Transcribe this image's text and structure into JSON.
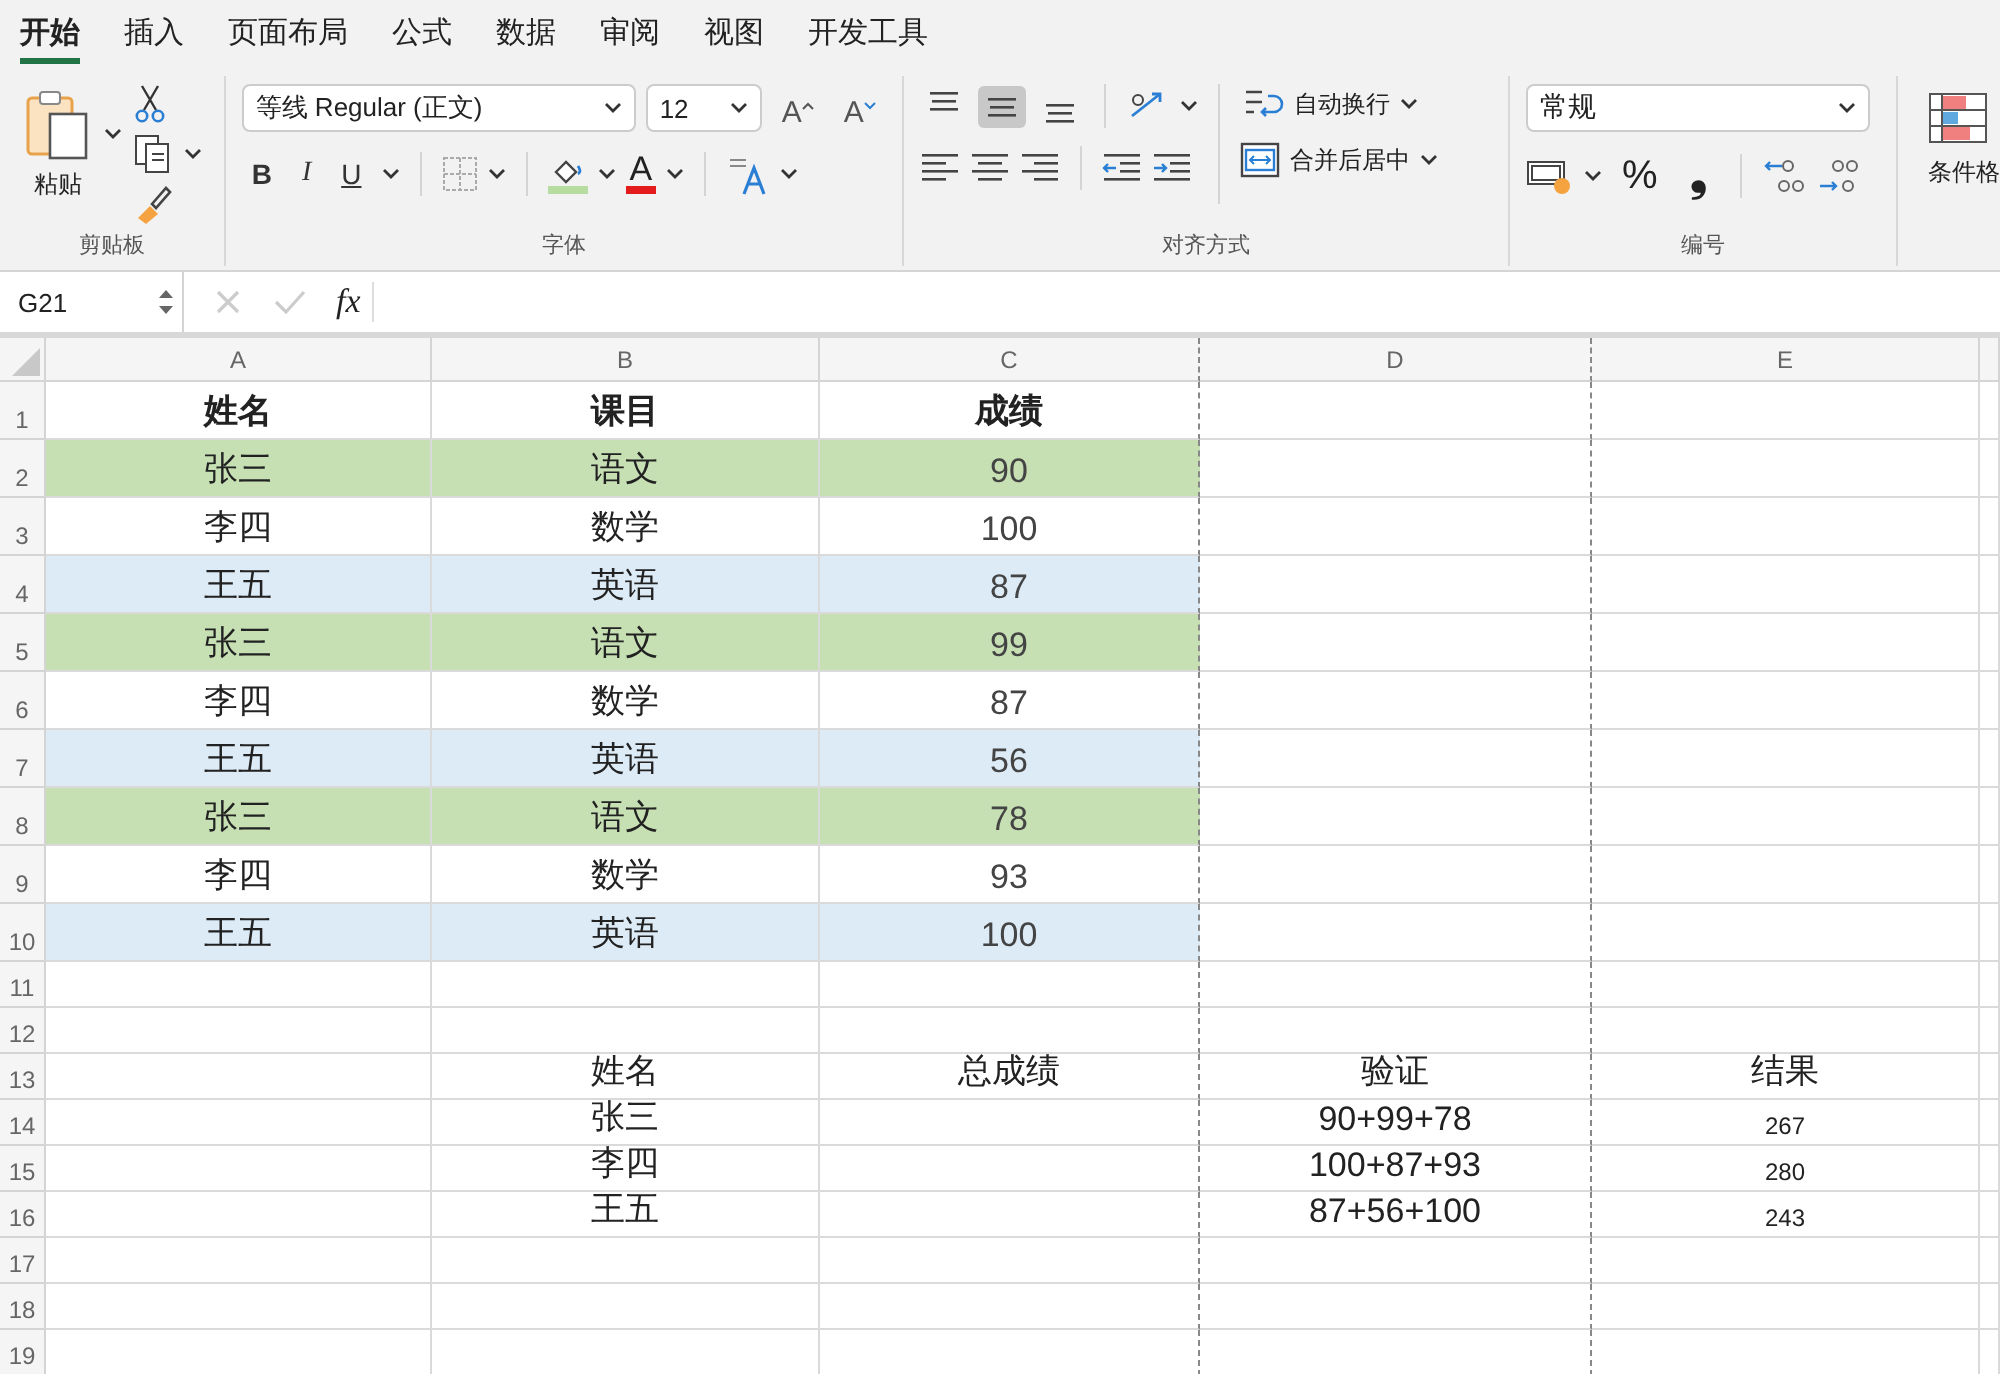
{
  "tabs": [
    {
      "label": "开始",
      "selected": true
    },
    {
      "label": "插入",
      "selected": false
    },
    {
      "label": "页面布局",
      "selected": false
    },
    {
      "label": "公式",
      "selected": false
    },
    {
      "label": "数据",
      "selected": false
    },
    {
      "label": "审阅",
      "selected": false
    },
    {
      "label": "视图",
      "selected": false
    },
    {
      "label": "开发工具",
      "selected": false
    }
  ],
  "ribbon": {
    "clipboard": {
      "paste_label": "粘贴",
      "group_label": "剪贴板"
    },
    "font": {
      "font_name": "等线 Regular (正文)",
      "font_size": "12",
      "size_buttons": [
        "A",
        "A"
      ],
      "style_buttons": [
        "B",
        "I",
        "U"
      ],
      "font_color_label": "A",
      "group_label": "字体"
    },
    "alignment": {
      "vertical_align": [
        {
          "selected": false
        },
        {
          "selected": true
        },
        {
          "selected": false
        }
      ],
      "wrap_label": "自动换行",
      "merge_label": "合并后居中",
      "group_label": "对齐方式"
    },
    "number": {
      "format": "常规",
      "percent": "%",
      "comma": "❟",
      "group_label": "编号"
    },
    "styles": {
      "conditional_label": "条件格"
    }
  },
  "formula_bar": {
    "name_box": "G21",
    "fx_label": "fx"
  },
  "table": {
    "columns": [
      "A",
      "B",
      "C",
      "D",
      "E"
    ],
    "rows": [
      {
        "number": "1",
        "kind": "header",
        "cells": [
          "姓名",
          "课目",
          "成绩",
          "",
          ""
        ]
      },
      {
        "number": "2",
        "kind": "data",
        "color": "#c6e0b4",
        "cells": [
          "张三",
          "语文",
          "90",
          "",
          ""
        ]
      },
      {
        "number": "3",
        "kind": "data",
        "color": "#ffffff",
        "cells": [
          "李四",
          "数学",
          "100",
          "",
          ""
        ]
      },
      {
        "number": "4",
        "kind": "data",
        "color": "#ddebf7",
        "cells": [
          "王五",
          "英语",
          "87",
          "",
          ""
        ]
      },
      {
        "number": "5",
        "kind": "data",
        "color": "#c6e0b4",
        "cells": [
          "张三",
          "语文",
          "99",
          "",
          ""
        ]
      },
      {
        "number": "6",
        "kind": "data",
        "color": "#ffffff",
        "cells": [
          "李四",
          "数学",
          "87",
          "",
          ""
        ]
      },
      {
        "number": "7",
        "kind": "data",
        "color": "#ddebf7",
        "cells": [
          "王五",
          "英语",
          "56",
          "",
          ""
        ]
      },
      {
        "number": "8",
        "kind": "data",
        "color": "#c6e0b4",
        "cells": [
          "张三",
          "语文",
          "78",
          "",
          ""
        ]
      },
      {
        "number": "9",
        "kind": "data",
        "color": "#ffffff",
        "cells": [
          "李四",
          "数学",
          "93",
          "",
          ""
        ]
      },
      {
        "number": "10",
        "kind": "data",
        "color": "#ddebf7",
        "cells": [
          "王五",
          "英语",
          "100",
          "",
          ""
        ]
      },
      {
        "number": "11",
        "kind": "empty",
        "cells": [
          "",
          "",
          "",
          "",
          ""
        ]
      },
      {
        "number": "12",
        "kind": "empty",
        "cells": [
          "",
          "",
          "",
          "",
          ""
        ]
      },
      {
        "number": "13",
        "kind": "summary",
        "cells": [
          "",
          "姓名",
          "总成绩",
          "验证",
          "结果"
        ]
      },
      {
        "number": "14",
        "kind": "summary",
        "cells": [
          "",
          "张三",
          "",
          "90+99+78",
          "267"
        ]
      },
      {
        "number": "15",
        "kind": "summary",
        "cells": [
          "",
          "李四",
          "",
          "100+87+93",
          "280"
        ]
      },
      {
        "number": "16",
        "kind": "summary",
        "cells": [
          "",
          "王五",
          "",
          "87+56+100",
          "243"
        ]
      },
      {
        "number": "17",
        "kind": "empty",
        "cells": [
          "",
          "",
          "",
          "",
          ""
        ]
      },
      {
        "number": "18",
        "kind": "empty",
        "cells": [
          "",
          "",
          "",
          "",
          ""
        ]
      },
      {
        "number": "19",
        "kind": "empty",
        "cells": [
          "",
          "",
          "",
          "",
          ""
        ]
      }
    ]
  }
}
